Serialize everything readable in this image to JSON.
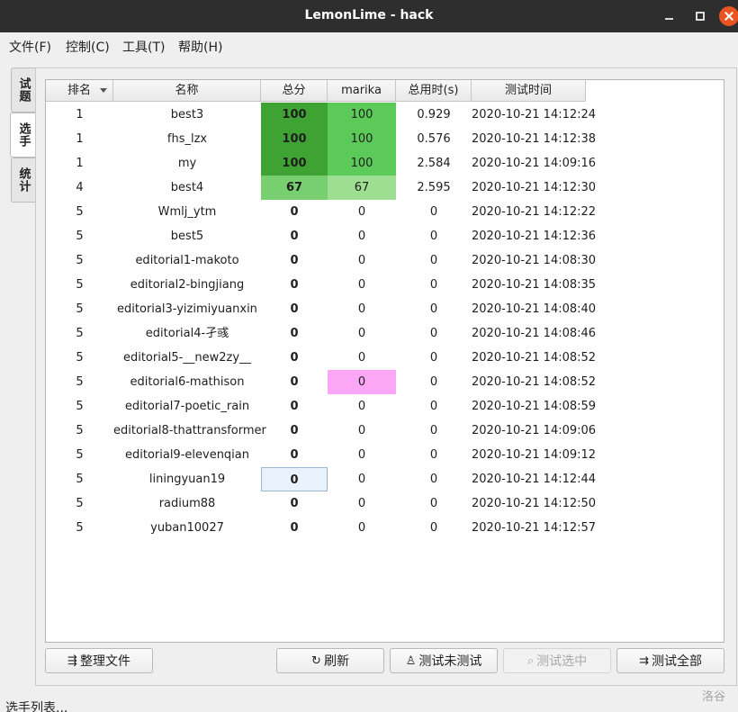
{
  "window": {
    "title": "LemonLime - hack"
  },
  "menu": [
    "文件(F)",
    "控制(C)",
    "工具(T)",
    "帮助(H)"
  ],
  "tabs": [
    {
      "label": "试题",
      "active": false
    },
    {
      "label": "选手",
      "active": true
    },
    {
      "label": "统计",
      "active": false
    }
  ],
  "table": {
    "headers": [
      "排名",
      "名称",
      "总分",
      "marika",
      "总用时(s)",
      "测试时间"
    ],
    "sort_column": "排名",
    "rows": [
      {
        "rank": "1",
        "name": "best3",
        "total": "100",
        "marika": "100",
        "time": "0.929",
        "tested_at": "2020-10-21 14:12:24",
        "total_color": "#3ea333",
        "marika_color": "#5cca59"
      },
      {
        "rank": "1",
        "name": "fhs_lzx",
        "total": "100",
        "marika": "100",
        "time": "0.576",
        "tested_at": "2020-10-21 14:12:38",
        "total_color": "#3ea333",
        "marika_color": "#5cca59"
      },
      {
        "rank": "1",
        "name": "my",
        "total": "100",
        "marika": "100",
        "time": "2.584",
        "tested_at": "2020-10-21 14:09:16",
        "total_color": "#3ea333",
        "marika_color": "#5cca59"
      },
      {
        "rank": "4",
        "name": "best4",
        "total": "67",
        "marika": "67",
        "time": "2.595",
        "tested_at": "2020-10-21 14:12:30",
        "total_color": "#77cf6f",
        "marika_color": "#9ede93"
      },
      {
        "rank": "5",
        "name": "Wmlj_ytm",
        "total": "0",
        "marika": "0",
        "time": "0",
        "tested_at": "2020-10-21 14:12:22"
      },
      {
        "rank": "5",
        "name": "best5",
        "total": "0",
        "marika": "0",
        "time": "0",
        "tested_at": "2020-10-21 14:12:36"
      },
      {
        "rank": "5",
        "name": "editorial1-makoto",
        "total": "0",
        "marika": "0",
        "time": "0",
        "tested_at": "2020-10-21 14:08:30"
      },
      {
        "rank": "5",
        "name": "editorial2-bingjiang",
        "total": "0",
        "marika": "0",
        "time": "0",
        "tested_at": "2020-10-21 14:08:35"
      },
      {
        "rank": "5",
        "name": "editorial3-yizimiyuanxin",
        "total": "0",
        "marika": "0",
        "time": "0",
        "tested_at": "2020-10-21 14:08:40"
      },
      {
        "rank": "5",
        "name": "editorial4-孑彧",
        "total": "0",
        "marika": "0",
        "time": "0",
        "tested_at": "2020-10-21 14:08:46"
      },
      {
        "rank": "5",
        "name": "editorial5-__new2zy__",
        "total": "0",
        "marika": "0",
        "time": "0",
        "tested_at": "2020-10-21 14:08:52"
      },
      {
        "rank": "5",
        "name": "editorial6-mathison",
        "total": "0",
        "marika": "0",
        "time": "0",
        "tested_at": "2020-10-21 14:08:52",
        "marika_color": "#fba7f5"
      },
      {
        "rank": "5",
        "name": "editorial7-poetic_rain",
        "total": "0",
        "marika": "0",
        "time": "0",
        "tested_at": "2020-10-21 14:08:59"
      },
      {
        "rank": "5",
        "name": "editorial8-thattransformer",
        "total": "0",
        "marika": "0",
        "time": "0",
        "tested_at": "2020-10-21 14:09:06"
      },
      {
        "rank": "5",
        "name": "editorial9-elevenqian",
        "total": "0",
        "marika": "0",
        "time": "0",
        "tested_at": "2020-10-21 14:09:12"
      },
      {
        "rank": "5",
        "name": "liningyuan19",
        "total": "0",
        "marika": "0",
        "time": "0",
        "tested_at": "2020-10-21 14:12:44",
        "total_selected": true
      },
      {
        "rank": "5",
        "name": "radium88",
        "total": "0",
        "marika": "0",
        "time": "0",
        "tested_at": "2020-10-21 14:12:50"
      },
      {
        "rank": "5",
        "name": "yuban10027",
        "total": "0",
        "marika": "0",
        "time": "0",
        "tested_at": "2020-10-21 14:12:57"
      }
    ]
  },
  "buttons": {
    "organize": {
      "label": "整理文件",
      "icon": "organize-files-icon"
    },
    "refresh": {
      "label": "刷新",
      "icon": "refresh-icon"
    },
    "judge_untested": {
      "label": "测试未测试",
      "icon": "user-icon"
    },
    "judge_selected": {
      "label": "测试选中",
      "icon": "search-icon",
      "disabled": true
    },
    "judge_all": {
      "label": "测试全部",
      "icon": "judge-all-icon"
    }
  },
  "status_bar": {
    "text": "选手列表..."
  },
  "watermark": "洛谷"
}
